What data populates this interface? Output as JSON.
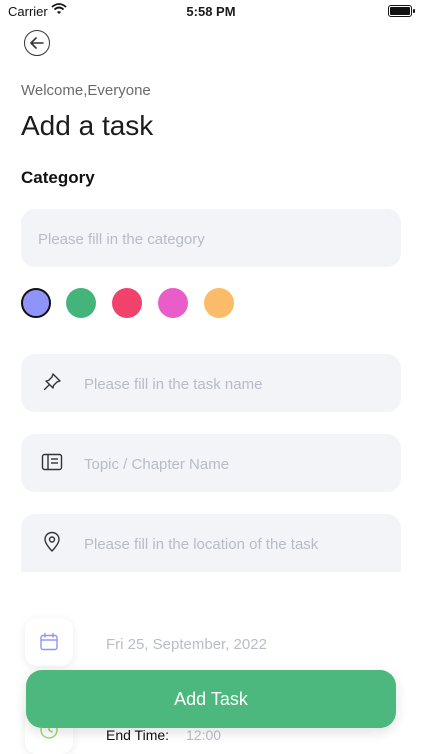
{
  "status_bar": {
    "carrier": "Carrier",
    "time": "5:58 PM"
  },
  "header": {
    "welcome": "Welcome,Everyone",
    "title": "Add a task"
  },
  "category": {
    "label": "Category",
    "placeholder": "Please fill in the category",
    "colors": [
      "#8f94fb",
      "#44b47a",
      "#f0426b",
      "#e85dc8",
      "#fcbb69"
    ],
    "selected_color": "#8f94fb"
  },
  "task_name": {
    "placeholder": "Please fill in the task name",
    "icon": "pin-icon"
  },
  "topic": {
    "placeholder": "Topic / Chapter Name",
    "icon": "notebook-icon"
  },
  "location": {
    "placeholder": "Please fill in the location of the task",
    "icon": "location-icon"
  },
  "date": {
    "value": "Fri 25, September, 2022",
    "icon": "calendar-icon"
  },
  "end_time": {
    "label": "End   Time:",
    "value": "12:00",
    "icon": "clock-icon"
  },
  "submit": {
    "label": "Add Task",
    "color": "#4cb87e"
  }
}
